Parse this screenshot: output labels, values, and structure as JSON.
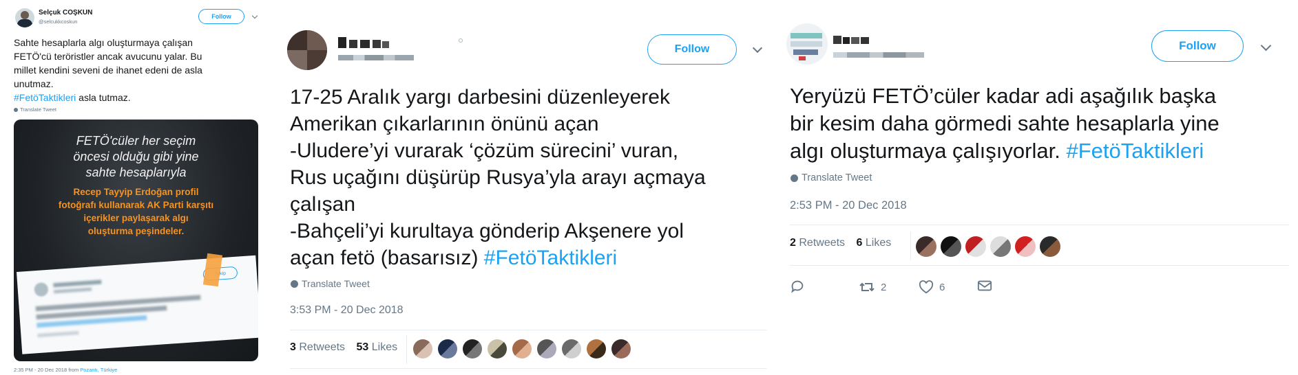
{
  "tweet1": {
    "display_name": "Selçuk COŞKUN",
    "handle": "@selcukkcoskun",
    "follow_label": "Follow",
    "text_lines": [
      "Sahte hesaplarla algı oluşturmaya çalışan",
      "FETÖ'cü teröristler ancak avucunu yalar. Bu",
      "millet kendini seveni de ihanet edeni de asla",
      "unutmaz."
    ],
    "hashtag": "#FetöTaktikleri",
    "text_after_hashtag": " asla tutmaz.",
    "translate": "Translate Tweet",
    "image": {
      "white_lines": [
        "FETÖ'cüler her seçim",
        "öncesi olduğu gibi yine",
        "sahte hesaplarıyla"
      ],
      "orange_lines": [
        "Recep Tayyip Erdoğan profil",
        "fotoğrafı kullanarak AK Parti karşıtı",
        "içerikler paylaşarak algı",
        "oluşturma peşindeler."
      ],
      "inner_button": "Takip"
    },
    "timestamp": "2:35 PM - 20 Dec 2018 from ",
    "location": "Pozantı, Türkiye"
  },
  "tweet2": {
    "follow_label": "Follow",
    "text_lines": [
      "17-25 Aralık yargı darbesini düzenleyerek",
      "Amerikan çıkarlarının önünü açan",
      "-Uludere’yi vurarak ‘çözüm sürecini’ vuran,",
      "Rus uçağını düşürüp Rusya’yla arayı açmaya",
      "çalışan",
      "-Bahçeli’yi kurultaya gönderip Akşenere yol"
    ],
    "last_line_prefix": "açan fetö (basarısız) ",
    "hashtag": "#FetöTaktikleri",
    "translate": "Translate Tweet",
    "timestamp": "3:53 PM - 20 Dec 2018",
    "retweets_count": "3",
    "retweets_label": "Retweets",
    "likes_count": "53",
    "likes_label": "Likes"
  },
  "tweet3": {
    "follow_label": "Follow",
    "text_lines": [
      "Yeryüzü FETÖ’cüler kadar adi aşağılık başka",
      "bir kesim daha görmedi sahte hesaplarla yine"
    ],
    "last_line_prefix": "algı oluşturmaya çalışıyorlar. ",
    "hashtag": "#FetöTaktikleri",
    "translate": "Translate Tweet",
    "timestamp": "2:53 PM - 20 Dec 2018",
    "retweets_count": "2",
    "retweets_label": "Retweets",
    "likes_count": "6",
    "likes_label": "Likes",
    "action_retweet_count": "2",
    "action_like_count": "6"
  },
  "colors": {
    "accent": "#1da1f2",
    "meta": "#657786",
    "orange": "#f7931e"
  },
  "icons": [
    "globe-icon",
    "chevron-down-icon",
    "reply-icon",
    "retweet-icon",
    "heart-icon",
    "message-icon"
  ]
}
